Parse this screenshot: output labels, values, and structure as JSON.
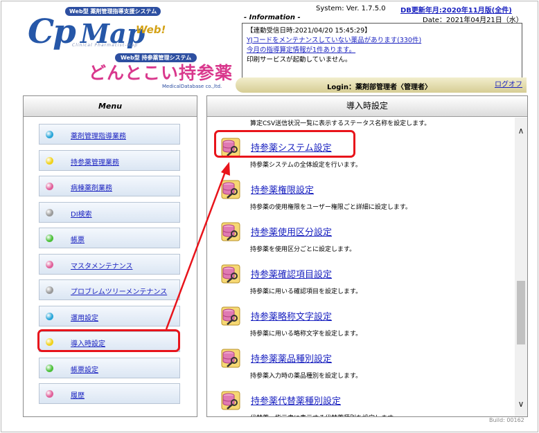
{
  "logo": {
    "badge_top": "Web型 薬剤管理指導支援システム",
    "cp": "Cp",
    "map": "Map",
    "web": "Web!",
    "subtitle": "Clinical Pharmacist-Map",
    "badge_bottom": "Web型 持参薬管理システム",
    "product_jp": "どんとこい持参薬",
    "corp": "MedicalDatabase co.,ltd."
  },
  "header": {
    "system_version": "System: Ver. 1.7.5.0",
    "db_update": "DB更新年月:2020年11月版(全件)",
    "info_label": "- Information -",
    "date": "Date：2021年04月21日（水）",
    "info_lines": [
      {
        "text": "【連動受信日時:2021/04/20 15:45:29】",
        "link": false
      },
      {
        "text": "YJコードをメンテナンスしていない薬品があります(330件)",
        "link": true
      },
      {
        "text": "今月の指導算定情報が1件あります。",
        "link": true
      },
      {
        "text": "印刷サービスが起動していません。",
        "link": false
      }
    ],
    "login": "Login：薬剤部管理者〈管理者〉",
    "logoff": "ログオフ"
  },
  "menu": {
    "title": "Menu",
    "items": [
      {
        "label": "薬剤管理指導業務",
        "color": "#2aa6d9"
      },
      {
        "label": "持参薬管理業務",
        "color": "#f0d21c"
      },
      {
        "label": "病棟薬剤業務",
        "color": "#e0609a"
      },
      {
        "label": "DI検索",
        "color": "#9a9a9a"
      },
      {
        "label": "帳票",
        "color": "#4cc03a"
      },
      {
        "label": "マスタメンテナンス",
        "color": "#e0609a"
      },
      {
        "label": "プロブレムツリーメンテナンス",
        "color": "#9a9a9a"
      },
      {
        "label": "運用設定",
        "color": "#2aa6d9"
      },
      {
        "label": "導入時設定",
        "color": "#f0d21c"
      },
      {
        "label": "帳票設定",
        "color": "#4cc03a"
      },
      {
        "label": "履歴",
        "color": "#e0609a"
      }
    ]
  },
  "main": {
    "title": "導入時設定",
    "cut_desc": "算定CSV送信状況一覧に表示するステータス名称を設定します。",
    "entries": [
      {
        "title": "持参薬システム設定",
        "desc": "持参薬システムの全体設定を行います。"
      },
      {
        "title": "持参薬権限設定",
        "desc": "持参薬の使用権限をユーザー権限ごと詳細に設定します。"
      },
      {
        "title": "持参薬使用区分設定",
        "desc": "持参薬を使用区分ごとに設定します。"
      },
      {
        "title": "持参薬確認項目設定",
        "desc": "持参薬に用いる確認項目を設定します。"
      },
      {
        "title": "持参薬略称文字設定",
        "desc": "持参薬に用いる略称文字を設定します。"
      },
      {
        "title": "持参薬薬品種別設定",
        "desc": "持参薬入力時の薬品種別を設定します。"
      },
      {
        "title": "持参薬代替薬種別設定",
        "desc": "代替薬、指示書に表示する代替薬種別を設定します。"
      }
    ]
  },
  "footer": {
    "build": "Build: 00162"
  },
  "annotation_color": "#e8141b"
}
